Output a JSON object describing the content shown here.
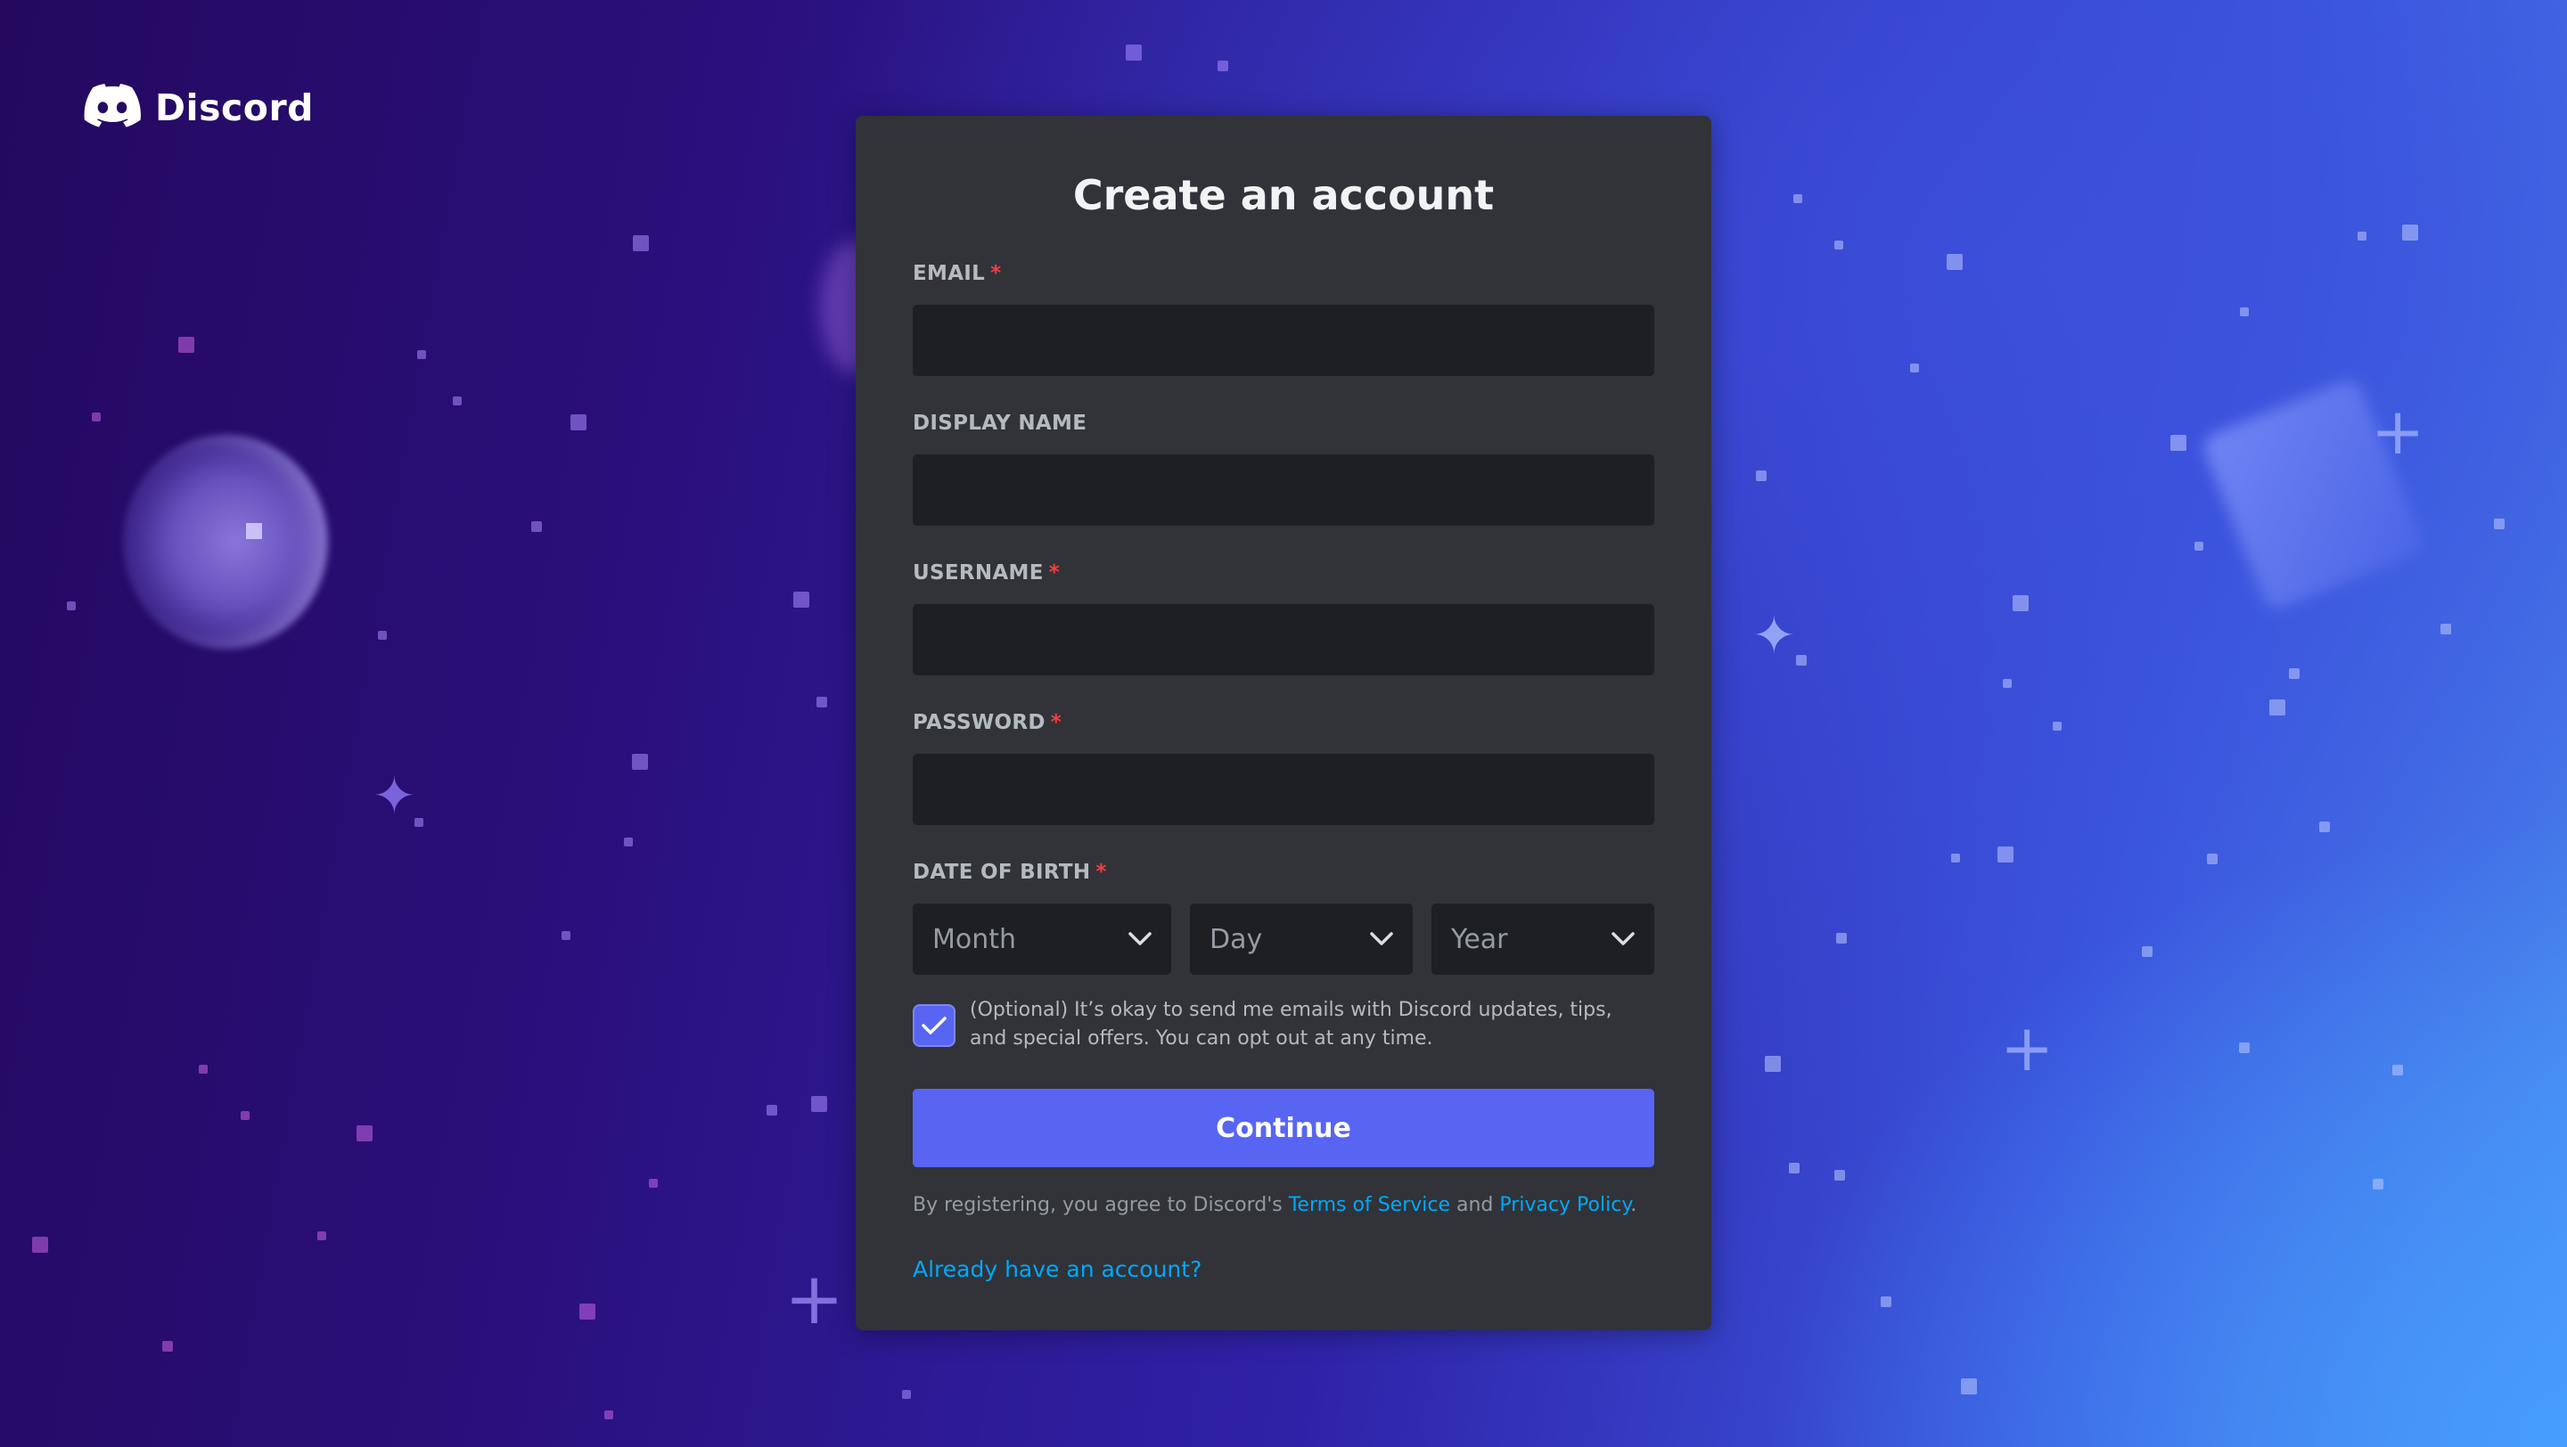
{
  "brand": {
    "name": "Discord",
    "icon": "discord-logo-icon"
  },
  "form": {
    "title": "Create an account",
    "required_marker": "*",
    "fields": {
      "email": {
        "label": "EMAIL",
        "value": "",
        "required": true
      },
      "display_name": {
        "label": "DISPLAY NAME",
        "value": "",
        "required": false
      },
      "username": {
        "label": "USERNAME",
        "value": "",
        "required": true
      },
      "password": {
        "label": "PASSWORD",
        "value": "",
        "required": true
      }
    },
    "date_of_birth": {
      "label": "DATE OF BIRTH",
      "required": true,
      "month": {
        "value": "Month",
        "icon": "chevron-down-icon"
      },
      "day": {
        "value": "Day",
        "icon": "chevron-down-icon"
      },
      "year": {
        "value": "Year",
        "icon": "chevron-down-icon"
      }
    },
    "optin": {
      "checked": true,
      "text": "(Optional) It’s okay to send me emails with Discord updates, tips, and special offers. You can opt out at any time."
    },
    "continue_label": "Continue",
    "legal": {
      "prefix": "By registering, you agree to Discord's ",
      "terms_label": "Terms of Service",
      "middle": " and ",
      "privacy_label": "Privacy Policy",
      "suffix": "."
    },
    "login_link": "Already have an account?"
  },
  "colors": {
    "card_bg": "#313338",
    "input_bg": "#1e1f22",
    "accent": "#5865f2",
    "link": "#00a8fc",
    "required": "#f23f42"
  }
}
